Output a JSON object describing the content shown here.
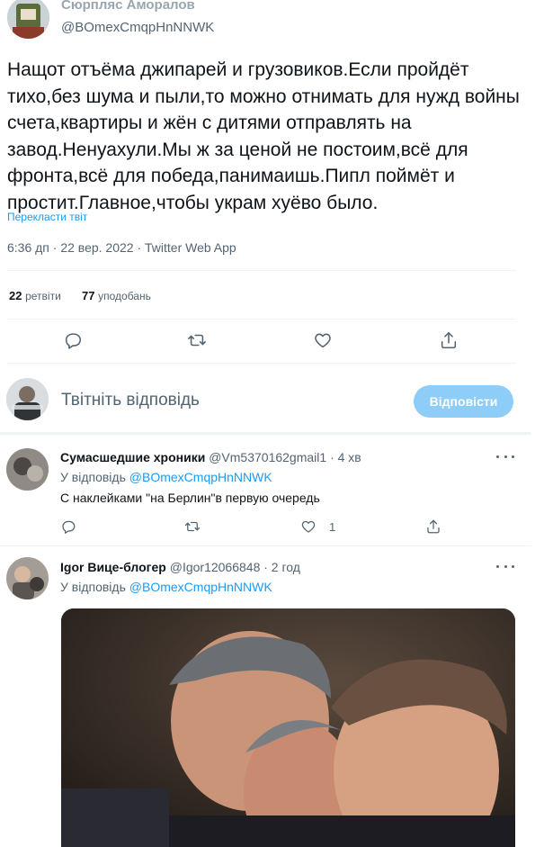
{
  "tweet": {
    "author_name": "Сюрпляс Аморалов",
    "author_handle": "@BOmexCmqpHnNNWK",
    "text": "Нащот отъёма джипарей и грузовиков.Если пройдёт тихо,без шума и пыли,то можно отнимать для нужд войны счета,квартиры и жён с дитями отправлять на завод.Ненуахули.Мы ж за ценой не постоим,всё для фронта,всё для победа,панимаишь.Пипл поймёт и простит.Главное,чтобы украм хуёво было.",
    "translate_label": "Перекласти твіт",
    "meta": "6:36 дп · 22 вер. 2022 · Twitter Web App",
    "retweets_count": "22",
    "retweets_label": "ретвіти",
    "likes_count": "77",
    "likes_label": "уподобань",
    "actions": [
      "reply-icon",
      "retweet-icon",
      "like-icon",
      "share-icon"
    ]
  },
  "composer": {
    "placeholder": "Твітніть відповідь",
    "button_label": "Відповісти"
  },
  "replies": [
    {
      "name": "Сумасшедшие хроники",
      "handle": "@Vm5370162gmail1",
      "time": "· 4 хв",
      "reply_prefix": "У відповідь",
      "reply_to": "@BOmexCmqpHnNNWK",
      "text": "С наклейками \"на Берлин\"в первую очередь",
      "like_count": "1"
    },
    {
      "name": "Igor Вице-блогер",
      "handle": "@Igor12066848",
      "time": "· 2 год",
      "reply_prefix": "У відповідь",
      "reply_to": "@BOmexCmqpHnNNWK"
    }
  ],
  "colors": {
    "accent": "#1d9bf0",
    "muted": "#536471",
    "button_disabled": "#8ecdf8"
  }
}
